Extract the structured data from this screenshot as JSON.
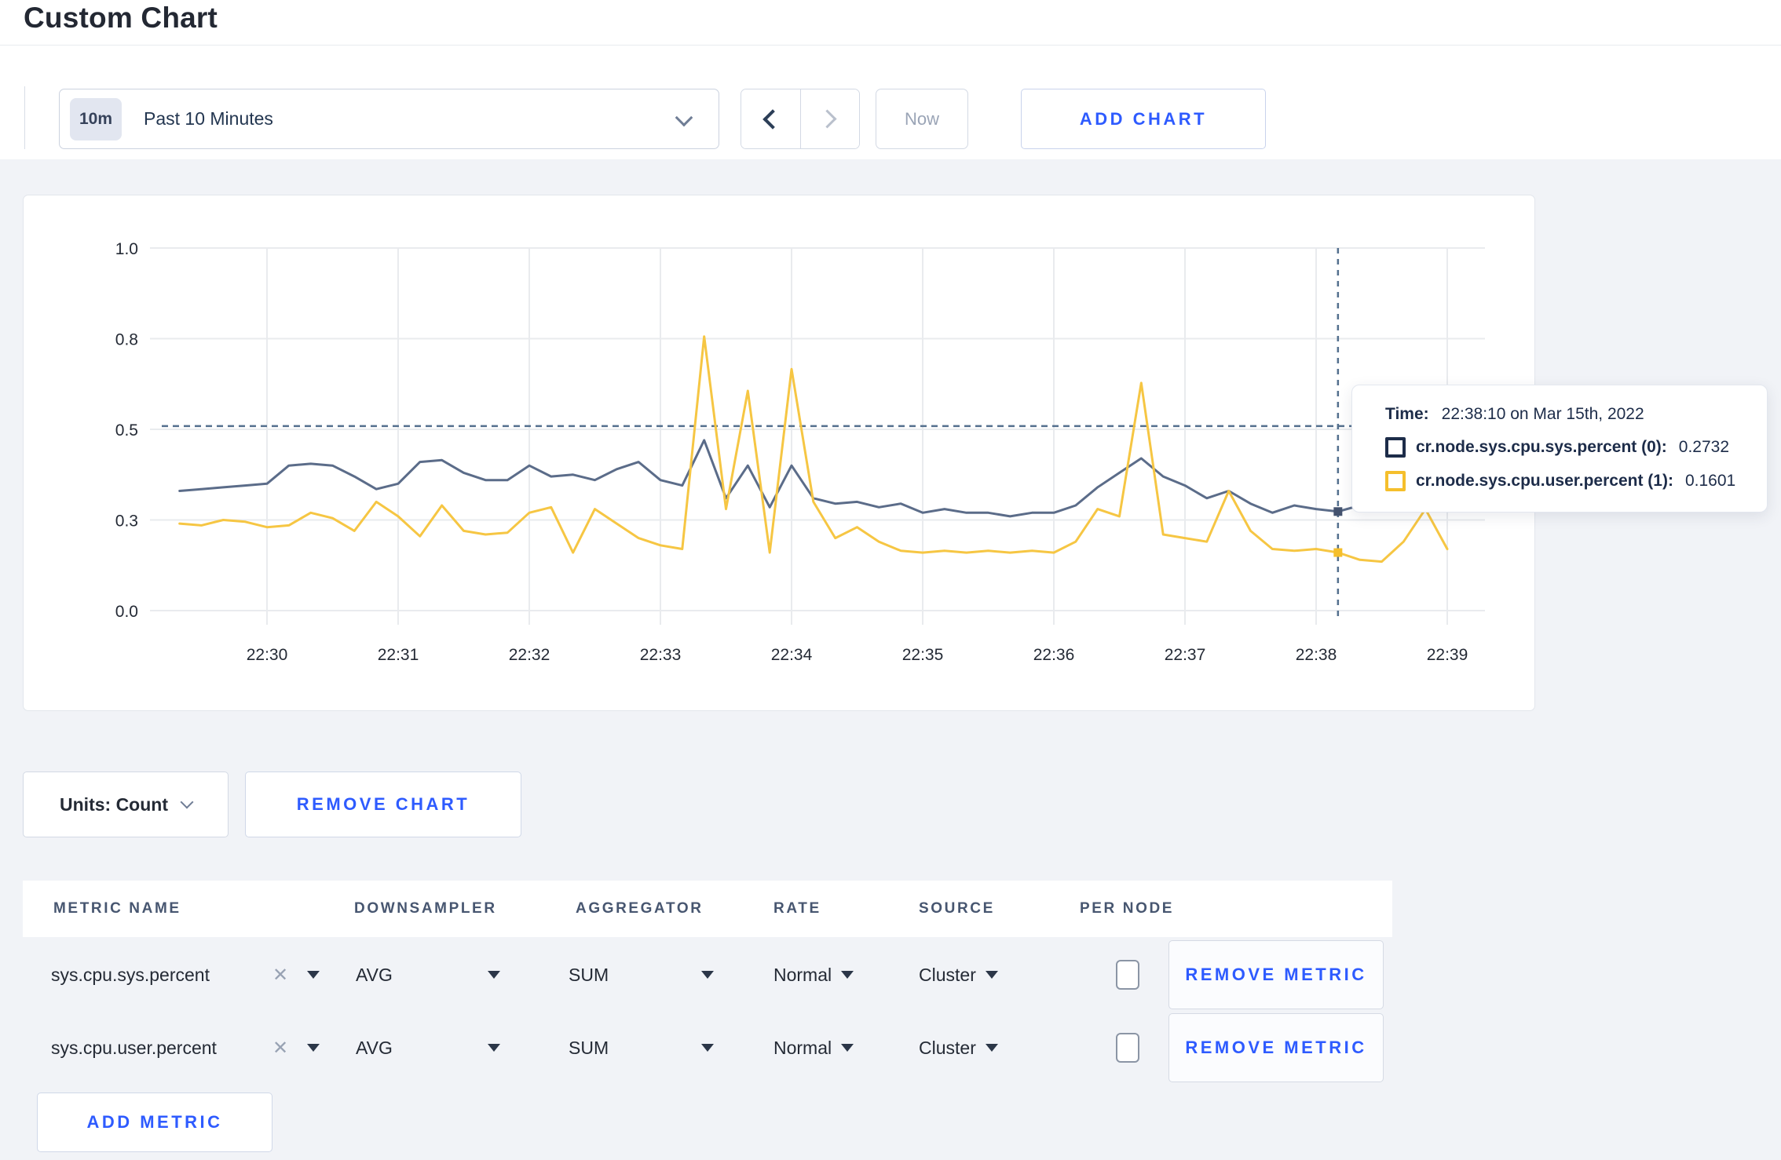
{
  "page": {
    "title": "Custom Chart"
  },
  "toolbar": {
    "time_range_badge": "10m",
    "time_range_label": "Past 10 Minutes",
    "now_label": "Now",
    "add_chart_label": "ADD CHART"
  },
  "chart": {
    "tooltip": {
      "time_label": "Time:",
      "time_value": "22:38:10 on Mar 15th, 2022",
      "rows": [
        {
          "name": "cr.node.sys.cpu.sys.percent (0):",
          "value": "0.2732",
          "swatch": "#1d2c49"
        },
        {
          "name": "cr.node.sys.cpu.user.percent (1):",
          "value": "0.1601",
          "swatch": "#f5bf2c"
        }
      ]
    }
  },
  "chart_data": {
    "type": "line",
    "title": "",
    "xlabel": "",
    "ylabel": "",
    "ylim": [
      0,
      1
    ],
    "grid": true,
    "legend_position": "tooltip",
    "x_tick_labels": [
      "22:30",
      "22:31",
      "22:32",
      "22:33",
      "22:34",
      "22:35",
      "22:36",
      "22:37",
      "22:38",
      "22:39"
    ],
    "y_tick_values": [
      1.0,
      0.75,
      0.5,
      0.25,
      0.0
    ],
    "y_tick_labels": [
      "1.0",
      "0.8",
      "0.5",
      "0.3",
      "0.0"
    ],
    "x_base_time": "22:30:00",
    "series_start_time": "22:29:20",
    "sample_interval_seconds": 10,
    "hover_guide_value": 0.509,
    "crosshair_time": "22:38:10",
    "series": [
      {
        "name": "cr.node.sys.cpu.sys.percent",
        "color": "#5b6c89",
        "values": [
          0.33,
          0.335,
          0.34,
          0.345,
          0.35,
          0.4,
          0.405,
          0.4,
          0.37,
          0.335,
          0.35,
          0.41,
          0.415,
          0.38,
          0.36,
          0.36,
          0.4,
          0.37,
          0.375,
          0.36,
          0.39,
          0.41,
          0.36,
          0.345,
          0.47,
          0.31,
          0.4,
          0.285,
          0.4,
          0.31,
          0.295,
          0.3,
          0.285,
          0.295,
          0.27,
          0.28,
          0.27,
          0.27,
          0.26,
          0.27,
          0.27,
          0.29,
          0.34,
          0.38,
          0.42,
          0.37,
          0.345,
          0.31,
          0.33,
          0.295,
          0.27,
          0.29,
          0.28,
          0.2732,
          0.29,
          0.3,
          0.29,
          0.28,
          0.3
        ]
      },
      {
        "name": "cr.node.sys.cpu.user.percent",
        "color": "#f6c643",
        "values": [
          0.24,
          0.235,
          0.25,
          0.245,
          0.23,
          0.235,
          0.27,
          0.255,
          0.22,
          0.3,
          0.26,
          0.205,
          0.29,
          0.22,
          0.21,
          0.215,
          0.27,
          0.285,
          0.16,
          0.28,
          0.24,
          0.2,
          0.18,
          0.17,
          0.756,
          0.28,
          0.606,
          0.16,
          0.666,
          0.3,
          0.2,
          0.23,
          0.19,
          0.165,
          0.16,
          0.165,
          0.16,
          0.165,
          0.16,
          0.165,
          0.16,
          0.19,
          0.28,
          0.26,
          0.628,
          0.21,
          0.2,
          0.19,
          0.33,
          0.22,
          0.17,
          0.165,
          0.17,
          0.1601,
          0.14,
          0.135,
          0.19,
          0.28,
          0.17
        ]
      }
    ],
    "cursor_points": [
      {
        "series": 0,
        "value": 0.2732,
        "dot_color": "#44536f"
      },
      {
        "series": 1,
        "value": 0.1601,
        "dot_color": "#f5bf2c"
      }
    ]
  },
  "units_row": {
    "units_label": "Units: Count",
    "remove_chart_label": "REMOVE CHART"
  },
  "table": {
    "headers": [
      "METRIC NAME",
      "DOWNSAMPLER",
      "AGGREGATOR",
      "RATE",
      "SOURCE",
      "PER NODE"
    ],
    "rows": [
      {
        "metric": "sys.cpu.sys.percent",
        "downsampler": "AVG",
        "aggregator": "SUM",
        "rate": "Normal",
        "source": "Cluster",
        "per_node_checked": false,
        "remove_label": "REMOVE METRIC"
      },
      {
        "metric": "sys.cpu.user.percent",
        "downsampler": "AVG",
        "aggregator": "SUM",
        "rate": "Normal",
        "source": "Cluster",
        "per_node_checked": false,
        "remove_label": "REMOVE METRIC"
      }
    ],
    "add_metric_label": "ADD METRIC"
  },
  "colors": {
    "accent_blue": "#2e5bff",
    "series_sys": "#5b6c89",
    "series_user": "#f6c643",
    "crosshair": "#54708e",
    "content_bg": "#f1f3f7"
  }
}
